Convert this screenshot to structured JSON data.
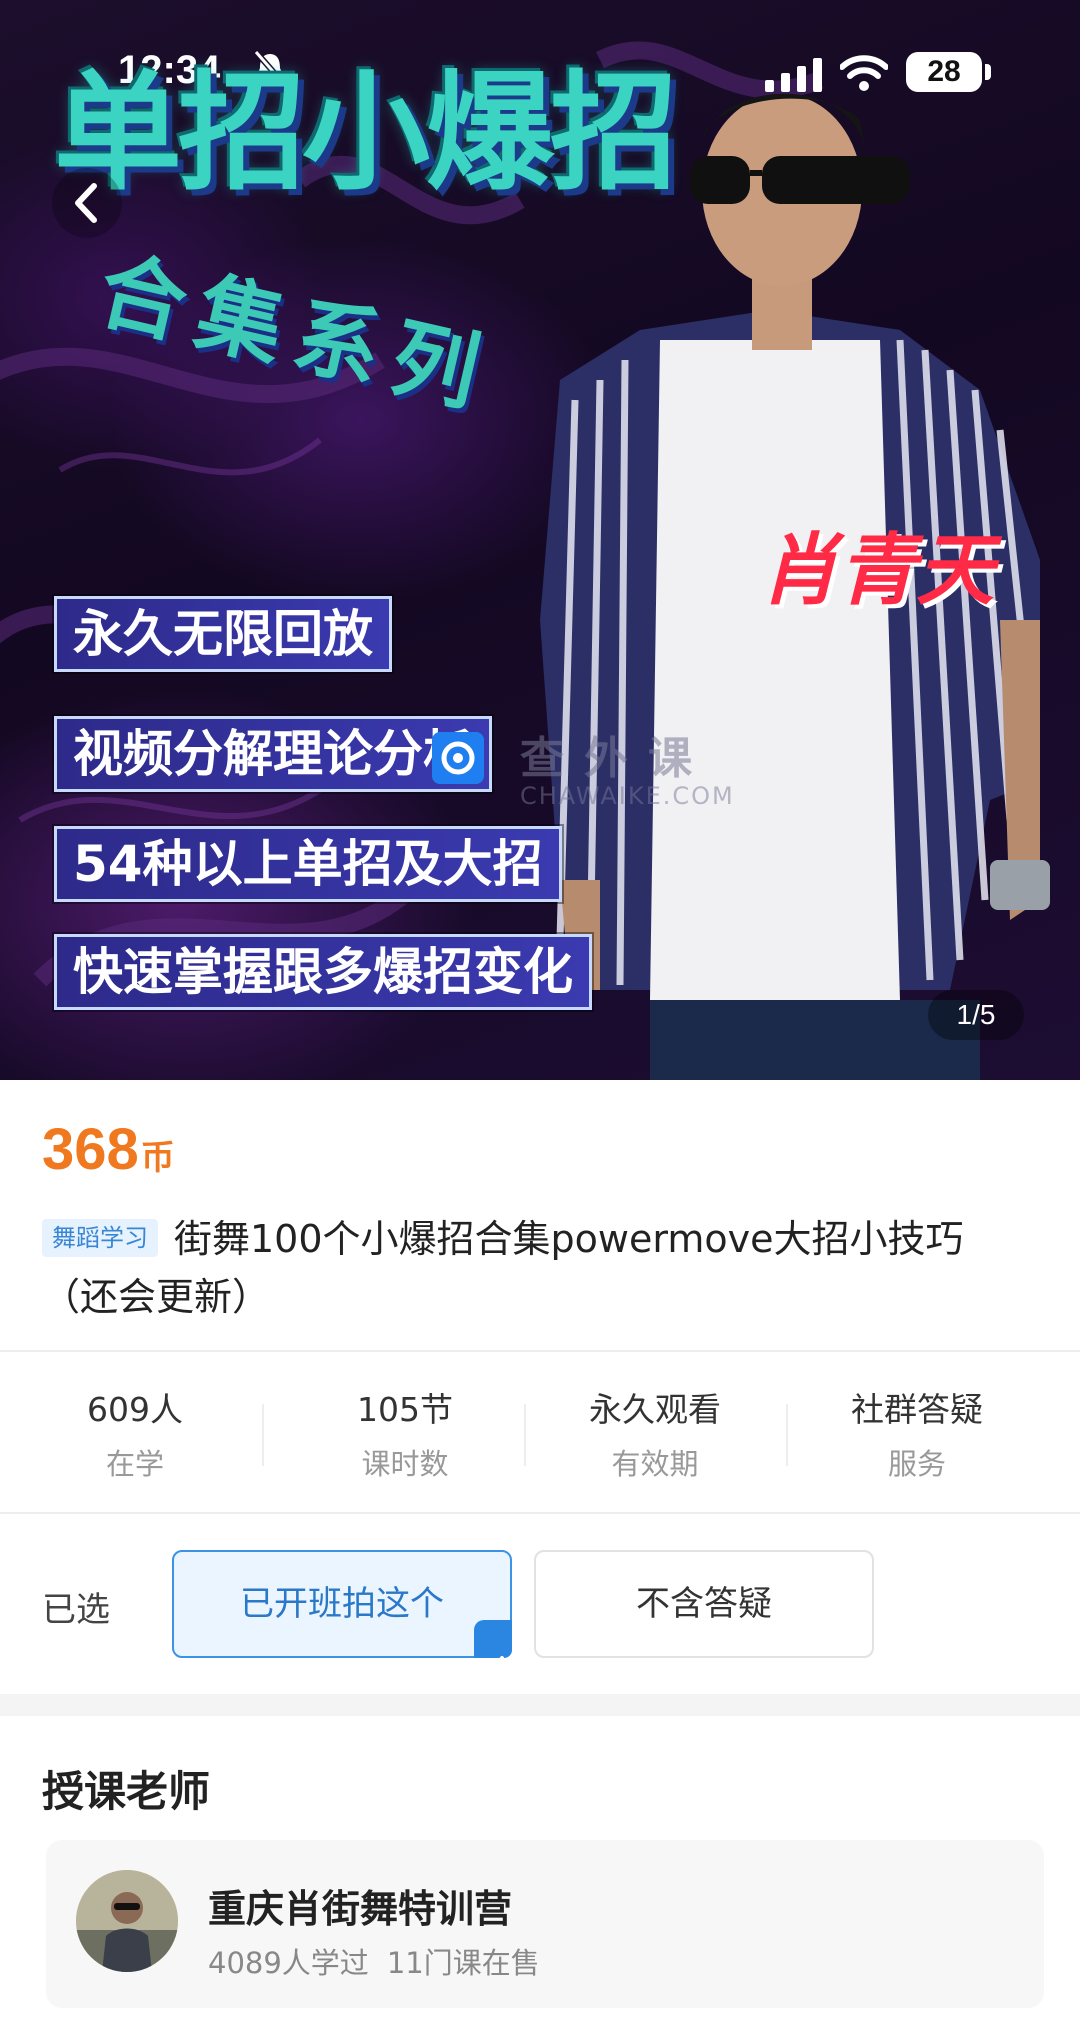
{
  "status_bar": {
    "time": "12:34",
    "battery": "28"
  },
  "hero": {
    "title": "单招小爆招",
    "subtitle": "合集系列",
    "person_name": "肖青天",
    "features": [
      "永久无限回放",
      "视频分解理论分析",
      "54种以上单招及大招",
      "快速掌握跟多爆招变化"
    ],
    "watermark": "查外课",
    "watermark_sub": "CHAWAIKE.COM",
    "page_indicator": "1/5",
    "colors": {
      "title": "#3bd4c2",
      "name": "#ff2a45",
      "feature_bg": "#2d2a8a"
    }
  },
  "product": {
    "price": "368",
    "price_unit": "币",
    "tag": "舞蹈学习",
    "title": "街舞100个小爆招合集powermove大招小技巧（还会更新）"
  },
  "stats": [
    {
      "value": "609人",
      "label": "在学"
    },
    {
      "value": "105节",
      "label": "课时数"
    },
    {
      "value": "永久观看",
      "label": "有效期"
    },
    {
      "value": "社群答疑",
      "label": "服务"
    }
  ],
  "options": {
    "label": "已选",
    "items": [
      {
        "label": "已开班拍这个",
        "selected": true
      },
      {
        "label": "不含答疑",
        "selected": false
      }
    ]
  },
  "teacher": {
    "section_title": "授课老师",
    "name": "重庆肖街舞特训营",
    "learners": "4089人学过",
    "courses": "11门课在售"
  },
  "colors": {
    "price": "#f0781e",
    "accent": "#3b93e6"
  },
  "icons": [
    "back-icon",
    "bell-muted-icon",
    "signal-icon",
    "wifi-icon",
    "checkmark-icon"
  ]
}
